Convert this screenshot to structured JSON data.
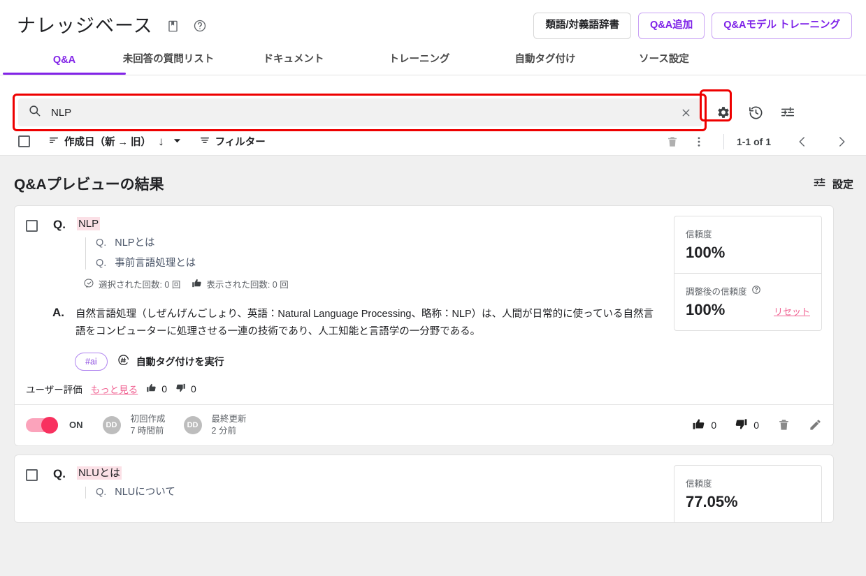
{
  "header": {
    "title": "ナレッジベース",
    "icons": [
      {
        "name": "book-icon"
      },
      {
        "name": "help-circle-icon"
      }
    ],
    "actions": [
      {
        "label": "類語/対義語辞書",
        "style": "gray"
      },
      {
        "label": "Q&A追加",
        "style": "purple"
      },
      {
        "label": "Q&Aモデル トレーニング",
        "style": "purple"
      }
    ]
  },
  "tabs": [
    {
      "label": "Q&A",
      "active": true
    },
    {
      "label": "未回答の質問リスト",
      "active": false
    },
    {
      "label": "ドキュメント",
      "active": false
    },
    {
      "label": "トレーニング",
      "active": false
    },
    {
      "label": "自動タグ付け",
      "active": false
    },
    {
      "label": "ソース設定",
      "active": false
    }
  ],
  "search": {
    "value": "NLP",
    "placeholder": "",
    "clear_label": "×",
    "icons": [
      {
        "name": "settings-gear-icon",
        "highlighted": true
      },
      {
        "name": "history-icon",
        "highlighted": false
      },
      {
        "name": "tune-icon",
        "highlighted": false
      }
    ]
  },
  "toolbar": {
    "sort_label": "作成日（新 → 旧）",
    "sort_direction": "↓",
    "filter_label": "フィルター",
    "page_count": "1-1 of 1",
    "delete_label": "削除",
    "more_label": "その他"
  },
  "results": {
    "title": "Q&Aプレビューの結果",
    "settings_label": "設定"
  },
  "cards": [
    {
      "q_letter": "Q.",
      "question": "NLP",
      "subquestions": [
        {
          "prefix": "Q.",
          "text": "NLPとは"
        },
        {
          "prefix": "Q.",
          "text": "事前言語処理とは"
        }
      ],
      "stats": [
        {
          "icon": "check-bubble-icon",
          "text": "選択された回数: 0 回"
        },
        {
          "icon": "thumb-up-icon",
          "text": "表示された回数: 0 回"
        }
      ],
      "a_letter": "A.",
      "answer": "自然言語処理（しぜんげんごしょり、英語：Natural Language Processing、略称：NLP）は、人間が日常的に使っている自然言語をコンピューターに処理させる一連の技術であり、人工知能と言語学の一分野である。",
      "tag": "#ai",
      "autotag_label": "自動タグ付けを実行",
      "confidence_label": "信頼度",
      "confidence_value": "100%",
      "adjusted_label": "調整後の信頼度",
      "adjusted_value": "100%",
      "reset_label": "リセット",
      "rating_label": "ユーザー評価",
      "more_label": "もっと見る",
      "rating_up": "0",
      "rating_down": "0",
      "toggle_state": "ON",
      "created_label": "初回作成",
      "created_value": "7 時間前",
      "created_avatar": "DD",
      "updated_label": "最終更新",
      "updated_value": "2 分前",
      "updated_avatar": "DD",
      "footer_up": "0",
      "footer_down": "0"
    },
    {
      "q_letter": "Q.",
      "question": "NLUとは",
      "subquestions": [
        {
          "prefix": "Q.",
          "text": "NLUについて"
        }
      ],
      "confidence_label": "信頼度",
      "confidence_value": "77.05%"
    }
  ],
  "colors": {
    "accent_purple": "#8224e8",
    "highlight_red": "#ee0000",
    "pink_link": "#f06292",
    "toggle_on": "#f8315f",
    "highlight_bg": "#fbe0e6"
  }
}
